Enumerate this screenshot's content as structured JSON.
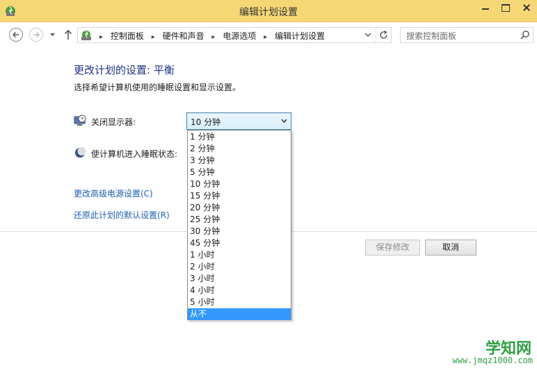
{
  "window": {
    "title": "编辑计划设置"
  },
  "nav": {
    "breadcrumb": [
      "控制面板",
      "硬件和声音",
      "电源选项",
      "编辑计划设置"
    ],
    "search_placeholder": "搜索控制面板"
  },
  "content": {
    "title": "更改计划的设置: 平衡",
    "subtitle": "选择希望计算机使用的睡眠设置和显示设置。",
    "display_off_label": "关闭显示器:",
    "sleep_label": "使计算机进入睡眠状态:",
    "display_off_value": "10 分钟",
    "link_advanced": "更改高级电源设置(C)",
    "link_restore": "还原此计划的默认设置(R)",
    "save_button": "保存修改",
    "cancel_button": "取消"
  },
  "dropdown": {
    "options": [
      "1 分钟",
      "2 分钟",
      "3 分钟",
      "5 分钟",
      "10 分钟",
      "15 分钟",
      "20 分钟",
      "25 分钟",
      "30 分钟",
      "45 分钟",
      "1 小时",
      "2 小时",
      "3 小时",
      "4 小时",
      "5 小时",
      "从不"
    ],
    "highlighted_index": 15
  },
  "watermark": {
    "logo": "学知网",
    "url": "www.jmqz1000.com"
  },
  "colors": {
    "titlebar": "#f6d776",
    "link": "#1a5fb4",
    "heading": "#1e3287",
    "highlight": "#3399ff"
  }
}
